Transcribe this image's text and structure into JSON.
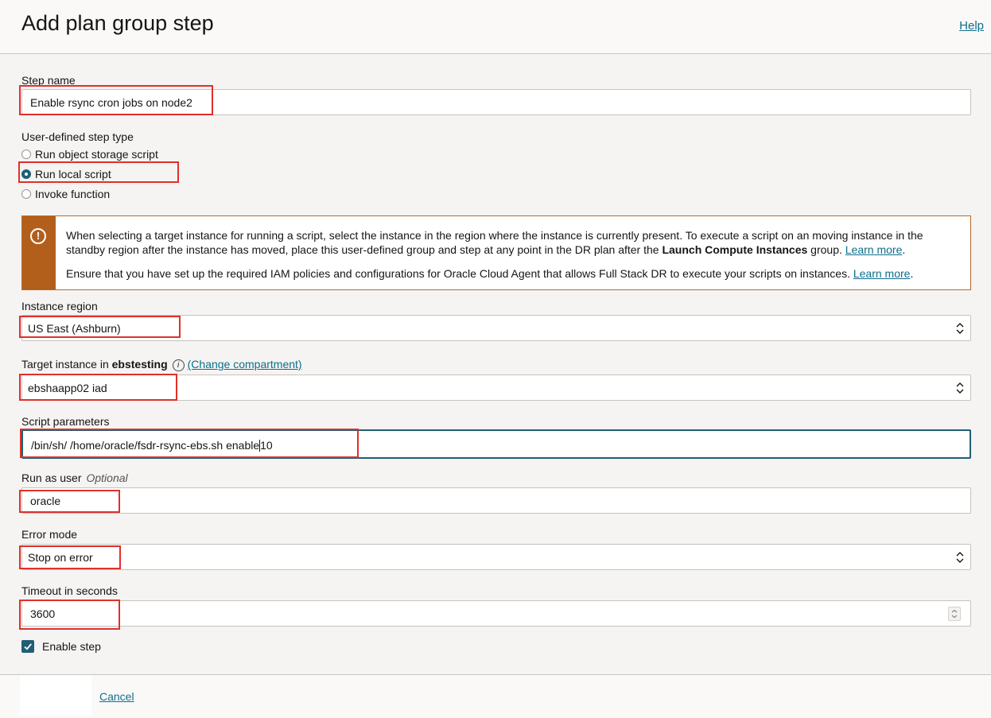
{
  "header": {
    "title": "Add plan group step",
    "help_link": "Help"
  },
  "step_name": {
    "label": "Step name",
    "value": "Enable rsync cron jobs on node2"
  },
  "step_type": {
    "label": "User-defined step type",
    "options": [
      {
        "label": "Run object storage script",
        "selected": false
      },
      {
        "label": "Run local script",
        "selected": true
      },
      {
        "label": "Invoke function",
        "selected": false
      }
    ]
  },
  "notice": {
    "icon": "warning-circle-icon",
    "para1_text": "When selecting a target instance for running a script, select the instance in the region where the instance is currently present. To execute a script on an moving instance in the standby region after the instance has moved, place this user-defined group and step at any point in the DR plan after the",
    "para1_bold": "Launch Compute Instances",
    "para1_tail": " group.",
    "para1_link": "Learn more",
    "para2_text": "Ensure that you have set up the required IAM policies and configurations for Oracle Cloud Agent that allows Full Stack DR to execute your scripts on instances.",
    "para2_link": "Learn more"
  },
  "instance_region": {
    "label": "Instance region",
    "value": "US East (Ashburn)"
  },
  "target_instance": {
    "label_prefix": "Target instance in",
    "compartment": "ebstesting",
    "change_link": "(Change compartment)",
    "value": "ebshaapp02 iad"
  },
  "script_parameters": {
    "label": "Script parameters",
    "value_before_cursor": "/bin/sh/ /home/oracle/fsdr-rsync-ebs.sh enable",
    "value_after_cursor": "10"
  },
  "run_as_user": {
    "label": "Run as user",
    "optional": "Optional",
    "value": "oracle"
  },
  "error_mode": {
    "label": "Error mode",
    "value": "Stop on error"
  },
  "timeout": {
    "label": "Timeout in seconds",
    "value": "3600"
  },
  "enable_step": {
    "label": "Enable step",
    "checked": true
  },
  "footer": {
    "cancel": "Cancel"
  },
  "colors": {
    "accent": "#1f5f75",
    "link": "#0d6e8c",
    "highlight": "#e0302a",
    "warning": "#b25f1c"
  }
}
